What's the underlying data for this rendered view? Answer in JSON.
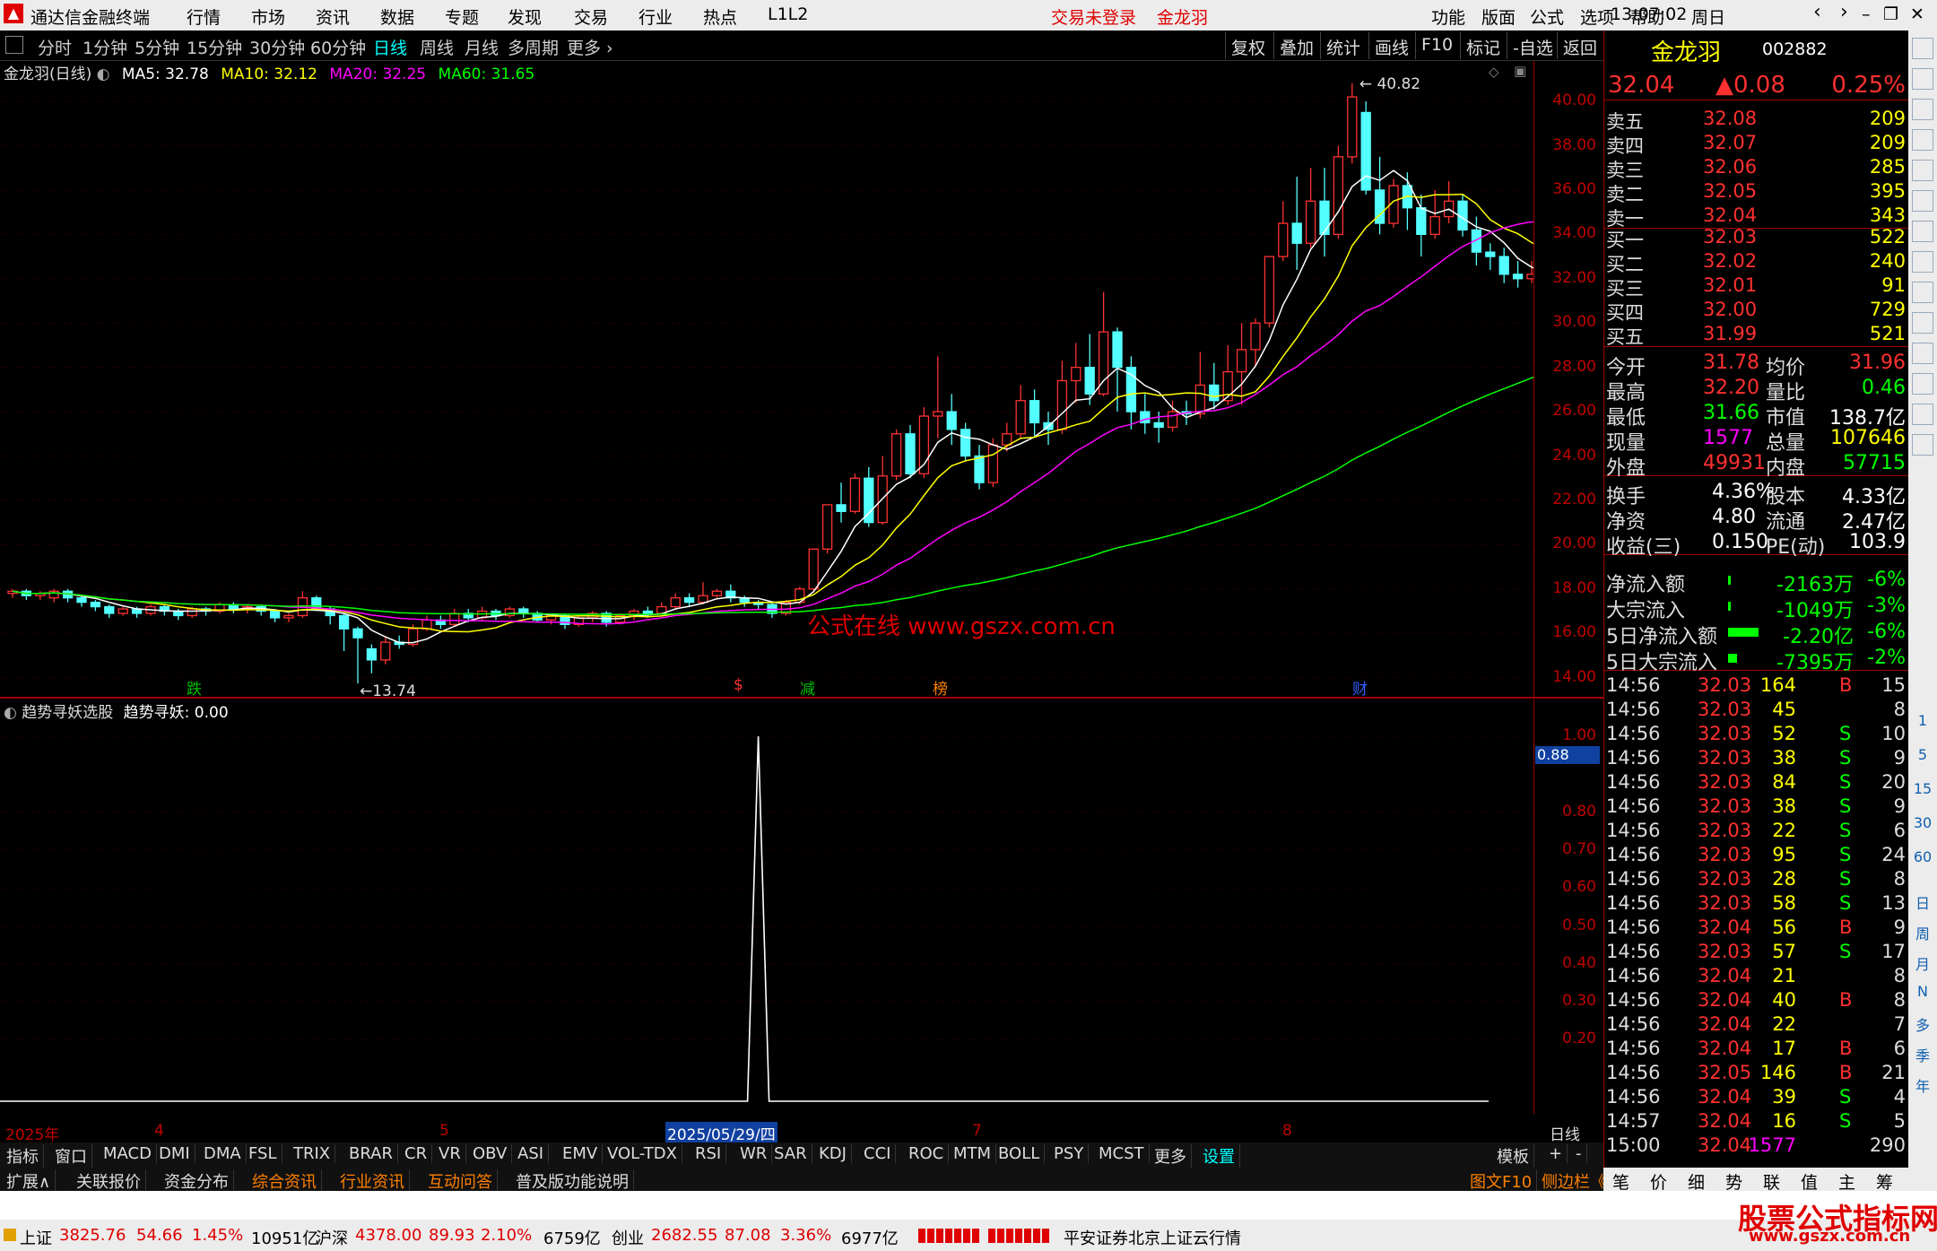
{
  "app": {
    "title": "通达信金融终端",
    "menus": [
      "行情",
      "市场",
      "资讯",
      "数据",
      "专题",
      "发现",
      "交易",
      "行业",
      "热点",
      "L1L2"
    ],
    "login_status": "交易未登录",
    "stock_name": "金龙羽",
    "right_menus": [
      "功能",
      "版面",
      "公式",
      "选项",
      "帮助"
    ],
    "time": "13:07:02",
    "weekday": "周日"
  },
  "period_tabs": [
    "分时",
    "1分钟",
    "5分钟",
    "15分钟",
    "30分钟",
    "60分钟",
    "日线",
    "周线",
    "月线",
    "多周期",
    "更多"
  ],
  "active_period": "日线",
  "toolbar_buttons": [
    "复权",
    "叠加",
    "统计",
    "画线",
    "F10",
    "标记",
    "-自选",
    "返回"
  ],
  "main_chart": {
    "header": "金龙羽(日线)",
    "ma_params": [
      {
        "label": "MA5: 32.78",
        "color": "#ffffff"
      },
      {
        "label": "MA10: 32.12",
        "color": "#ffff00"
      },
      {
        "label": "MA20: 32.25",
        "color": "#ff00ff"
      },
      {
        "label": "MA60: 31.65",
        "color": "#00ff00"
      }
    ],
    "y_ticks": [
      "40.00",
      "38.00",
      "36.00",
      "34.00",
      "32.00",
      "30.00",
      "28.00",
      "26.00",
      "24.00",
      "22.00",
      "20.00",
      "18.00",
      "16.00",
      "14.00"
    ],
    "high_label": "40.82",
    "low_label": "13.74",
    "watermark": "公式在线  www.gszx.com.cn",
    "event_markers": [
      {
        "text": "跌",
        "color": "#00c000"
      },
      {
        "text": "$",
        "color": "#ff3030"
      },
      {
        "text": "减",
        "color": "#00c000"
      },
      {
        "text": "榜",
        "color": "#ff8000"
      },
      {
        "text": "财",
        "color": "#3060ff"
      }
    ]
  },
  "chart_data": [
    {
      "type": "candlestick",
      "title": "金龙羽(日线)",
      "ylim": [
        13.5,
        41.5
      ],
      "candles": [
        [
          17.8,
          17.9,
          17.6,
          18.0
        ],
        [
          17.9,
          17.7,
          17.5,
          18.0
        ],
        [
          17.7,
          17.8,
          17.5,
          17.9
        ],
        [
          17.6,
          17.9,
          17.4,
          18.0
        ],
        [
          17.9,
          17.6,
          17.4,
          18.0
        ],
        [
          17.6,
          17.4,
          17.2,
          17.7
        ],
        [
          17.4,
          17.2,
          17.0,
          17.5
        ],
        [
          17.2,
          16.9,
          16.7,
          17.3
        ],
        [
          16.9,
          17.1,
          16.8,
          17.2
        ],
        [
          17.1,
          16.9,
          16.7,
          17.2
        ],
        [
          16.9,
          17.2,
          16.8,
          17.3
        ],
        [
          17.2,
          17.0,
          16.8,
          17.3
        ],
        [
          17.0,
          16.8,
          16.6,
          17.1
        ],
        [
          16.8,
          17.1,
          16.7,
          17.2
        ],
        [
          17.1,
          17.0,
          16.8,
          17.2
        ],
        [
          17.0,
          17.3,
          16.9,
          17.4
        ],
        [
          17.3,
          17.1,
          16.9,
          17.4
        ],
        [
          17.1,
          17.2,
          16.9,
          17.3
        ],
        [
          17.2,
          17.0,
          16.8,
          17.3
        ],
        [
          17.0,
          16.7,
          16.5,
          17.1
        ],
        [
          16.7,
          16.8,
          16.5,
          16.9
        ],
        [
          16.8,
          17.6,
          16.7,
          17.9
        ],
        [
          17.6,
          17.1,
          17.0,
          17.7
        ],
        [
          17.1,
          16.8,
          16.4,
          17.2
        ],
        [
          16.8,
          16.2,
          15.2,
          16.9
        ],
        [
          16.2,
          15.8,
          13.74,
          16.3
        ],
        [
          15.3,
          14.8,
          14.2,
          15.5
        ],
        [
          14.8,
          15.6,
          14.6,
          15.8
        ],
        [
          15.6,
          15.5,
          15.3,
          15.9
        ],
        [
          15.5,
          16.2,
          15.4,
          16.4
        ],
        [
          16.2,
          16.6,
          16.1,
          16.8
        ],
        [
          16.6,
          16.4,
          16.2,
          16.8
        ],
        [
          16.4,
          16.9,
          16.3,
          17.1
        ],
        [
          16.9,
          16.7,
          16.5,
          17.1
        ],
        [
          16.7,
          17.0,
          16.6,
          17.2
        ],
        [
          17.0,
          16.8,
          16.6,
          17.1
        ],
        [
          16.8,
          17.1,
          16.7,
          17.2
        ],
        [
          17.1,
          16.9,
          16.7,
          17.2
        ],
        [
          16.9,
          16.6,
          16.5,
          17.0
        ],
        [
          16.6,
          16.8,
          16.4,
          16.9
        ],
        [
          16.8,
          16.4,
          16.2,
          16.9
        ],
        [
          16.4,
          16.7,
          16.3,
          16.8
        ],
        [
          16.7,
          16.9,
          16.5,
          17.0
        ],
        [
          16.9,
          16.5,
          16.3,
          17.0
        ],
        [
          16.5,
          16.8,
          16.4,
          16.9
        ],
        [
          16.8,
          17.0,
          16.6,
          17.1
        ],
        [
          17.0,
          16.9,
          16.7,
          17.2
        ],
        [
          16.9,
          17.2,
          16.8,
          17.4
        ],
        [
          17.2,
          17.6,
          17.1,
          17.8
        ],
        [
          17.6,
          17.4,
          17.2,
          17.8
        ],
        [
          17.4,
          17.7,
          17.3,
          18.3
        ],
        [
          17.7,
          17.9,
          17.6,
          18.0
        ],
        [
          17.9,
          17.6,
          17.4,
          18.2
        ],
        [
          17.6,
          17.4,
          17.2,
          17.7
        ],
        [
          17.4,
          17.3,
          17.1,
          17.5
        ],
        [
          17.3,
          16.9,
          16.7,
          17.4
        ],
        [
          16.9,
          17.4,
          16.8,
          17.5
        ],
        [
          17.4,
          18.0,
          17.3,
          18.1
        ],
        [
          18.0,
          19.8,
          17.9,
          19.8
        ],
        [
          19.8,
          21.8,
          19.6,
          21.8
        ],
        [
          21.8,
          21.5,
          21.0,
          22.8
        ],
        [
          21.5,
          23.0,
          21.4,
          23.2
        ],
        [
          23.0,
          21.0,
          20.8,
          23.5
        ],
        [
          21.0,
          23.1,
          20.9,
          24.0
        ],
        [
          23.1,
          25.0,
          22.9,
          25.2
        ],
        [
          25.0,
          23.2,
          23.0,
          25.4
        ],
        [
          23.2,
          25.8,
          23.0,
          26.2
        ],
        [
          25.8,
          26.0,
          24.8,
          28.5
        ],
        [
          26.0,
          25.2,
          24.5,
          26.8
        ],
        [
          25.2,
          24.0,
          23.8,
          25.5
        ],
        [
          24.0,
          22.8,
          22.5,
          24.5
        ],
        [
          22.8,
          24.5,
          22.6,
          24.8
        ],
        [
          24.5,
          25.0,
          24.2,
          25.5
        ],
        [
          25.0,
          26.5,
          24.8,
          27.2
        ],
        [
          26.5,
          25.5,
          24.9,
          27.0
        ],
        [
          25.5,
          25.2,
          24.5,
          26.0
        ],
        [
          25.2,
          27.4,
          25.0,
          28.3
        ],
        [
          27.4,
          28.0,
          26.4,
          29.1
        ],
        [
          28.0,
          26.8,
          26.3,
          29.5
        ],
        [
          26.8,
          29.6,
          26.7,
          31.4
        ],
        [
          29.6,
          28.0,
          26.0,
          29.8
        ],
        [
          28.0,
          26.0,
          25.2,
          28.5
        ],
        [
          26.0,
          25.5,
          25.0,
          26.8
        ],
        [
          25.5,
          25.3,
          24.6,
          26.0
        ],
        [
          25.3,
          26.0,
          25.1,
          26.5
        ],
        [
          26.0,
          25.9,
          25.4,
          26.5
        ],
        [
          25.9,
          27.2,
          25.7,
          28.7
        ],
        [
          27.2,
          26.5,
          26.1,
          28.2
        ],
        [
          26.5,
          27.8,
          26.3,
          29.0
        ],
        [
          27.8,
          28.8,
          26.3,
          30.0
        ],
        [
          28.8,
          30.0,
          28.0,
          30.2
        ],
        [
          30.0,
          33.0,
          29.8,
          33.0
        ],
        [
          33.0,
          34.5,
          32.8,
          35.5
        ],
        [
          34.5,
          33.6,
          32.4,
          36.6
        ],
        [
          33.6,
          35.5,
          33.4,
          37.0
        ],
        [
          35.5,
          34.0,
          33.0,
          37.0
        ],
        [
          34.0,
          37.5,
          33.8,
          38.0
        ],
        [
          37.5,
          40.2,
          37.2,
          40.82
        ],
        [
          39.5,
          36.0,
          35.8,
          40.0
        ],
        [
          36.0,
          34.5,
          34.0,
          37.5
        ],
        [
          34.5,
          36.2,
          34.3,
          36.5
        ],
        [
          36.2,
          35.2,
          34.2,
          36.8
        ],
        [
          35.2,
          34.0,
          33.0,
          35.8
        ],
        [
          34.0,
          34.8,
          33.8,
          36.0
        ],
        [
          34.8,
          35.5,
          34.5,
          36.4
        ],
        [
          35.5,
          34.2,
          33.9,
          35.8
        ],
        [
          34.2,
          33.2,
          32.6,
          34.8
        ],
        [
          33.2,
          33.0,
          32.4,
          33.6
        ],
        [
          33.0,
          32.2,
          31.8,
          33.4
        ],
        [
          32.2,
          32.0,
          31.6,
          32.8
        ],
        [
          32.0,
          32.2,
          31.8,
          32.8
        ],
        [
          32.2,
          31.9,
          31.7,
          32.8
        ],
        [
          31.9,
          32.5,
          31.7,
          33.0
        ],
        [
          32.5,
          34.0,
          32.3,
          35.0
        ],
        [
          34.0,
          35.0,
          33.6,
          36.8
        ],
        [
          35.0,
          36.2,
          34.8,
          37.0
        ],
        [
          36.2,
          33.6,
          33.2,
          37.8
        ],
        [
          33.6,
          33.2,
          33.0,
          34.0
        ],
        [
          33.2,
          33.5,
          33.0,
          34.0
        ],
        [
          33.5,
          33.1,
          32.8,
          33.8
        ],
        [
          33.1,
          33.6,
          32.9,
          34.2
        ],
        [
          33.6,
          34.5,
          33.4,
          35.0
        ],
        [
          34.5,
          35.5,
          34.3,
          36.0
        ],
        [
          35.5,
          34.5,
          34.0,
          35.8
        ],
        [
          34.5,
          33.6,
          33.2,
          34.6
        ],
        [
          33.6,
          32.0,
          31.7,
          34.0
        ],
        [
          32.0,
          31.6,
          31.4,
          32.4
        ],
        [
          31.6,
          32.2,
          31.2,
          32.6
        ],
        [
          32.2,
          31.2,
          30.8,
          32.4
        ],
        [
          31.2,
          31.8,
          31.0,
          32.2
        ],
        [
          31.8,
          32.0,
          31.6,
          32.3
        ],
        [
          32.0,
          31.8,
          31.5,
          32.2
        ],
        [
          31.8,
          31.6,
          31.3,
          32.0
        ],
        [
          31.6,
          31.8,
          31.4,
          32.0
        ],
        [
          31.8,
          31.5,
          31.2,
          32.0
        ],
        [
          31.5,
          31.3,
          31.0,
          31.8
        ],
        [
          31.3,
          31.0,
          30.6,
          31.5
        ],
        [
          31.0,
          31.2,
          30.7,
          31.5
        ],
        [
          31.2,
          31.4,
          31.0,
          31.6
        ],
        [
          31.4,
          31.7,
          31.2,
          31.9
        ],
        [
          31.7,
          32.0,
          31.5,
          32.2
        ],
        [
          32.0,
          32.4,
          31.8,
          32.6
        ],
        [
          32.4,
          33.2,
          32.2,
          33.5
        ],
        [
          33.2,
          33.8,
          33.0,
          34.4
        ],
        [
          33.8,
          33.4,
          33.2,
          34.0
        ],
        [
          33.4,
          32.4,
          31.8,
          33.6
        ],
        [
          32.4,
          32.0,
          31.7,
          32.6
        ],
        [
          31.78,
          32.04,
          31.66,
          32.2
        ]
      ]
    },
    {
      "type": "line",
      "title": "趋势寻妖选股",
      "ylim": [
        0,
        1.05
      ],
      "spike_index": 54,
      "values_note_value": "0.00"
    }
  ],
  "sub_chart": {
    "header": "趋势寻妖选股",
    "param": "趋势寻妖: 0.00",
    "y_ticks": [
      "1.00",
      "0.80",
      "0.70",
      "0.60",
      "0.50",
      "0.40",
      "0.30",
      "0.20"
    ],
    "cursor_value": "0.88"
  },
  "time_axis": {
    "labels": [
      "2025年",
      "4",
      "5",
      "2025/05/29/四",
      "7",
      "8"
    ],
    "period_label": "日线"
  },
  "indicator_tabs": [
    "指标",
    "窗口",
    "MACD",
    "DMI",
    "DMA",
    "FSL",
    "TRIX",
    "BRAR",
    "CR",
    "VR",
    "OBV",
    "ASI",
    "EMV",
    "VOL-TDX",
    "RSI",
    "WR",
    "SAR",
    "KDJ",
    "CCI",
    "ROC",
    "MTM",
    "BOLL",
    "PSY",
    "MCST",
    "更多",
    "设置"
  ],
  "template_label": "模板",
  "ext_tabs": [
    "扩展∧",
    "关联报价",
    "资金分布",
    "综合资讯",
    "行业资讯",
    "互动问答",
    "普及版功能说明"
  ],
  "ext_right": [
    "图文F10",
    "侧边栏《"
  ],
  "quote": {
    "name": "金龙羽",
    "code": "002882",
    "price": "32.04",
    "change": "▲0.08",
    "pct": "0.25%",
    "sells": [
      [
        "卖五",
        "32.08",
        "209"
      ],
      [
        "卖四",
        "32.07",
        "209"
      ],
      [
        "卖三",
        "32.06",
        "285"
      ],
      [
        "卖二",
        "32.05",
        "395"
      ],
      [
        "卖一",
        "32.04",
        "343"
      ]
    ],
    "buys": [
      [
        "买一",
        "32.03",
        "522"
      ],
      [
        "买二",
        "32.02",
        "240"
      ],
      [
        "买三",
        "32.01",
        "91"
      ],
      [
        "买四",
        "32.00",
        "729"
      ],
      [
        "买五",
        "31.99",
        "521"
      ]
    ],
    "stats": [
      [
        "今开",
        "31.78",
        "均价",
        "31.96"
      ],
      [
        "最高",
        "32.20",
        "量比",
        "0.46"
      ],
      [
        "最低",
        "31.66",
        "市值",
        "138.7亿"
      ],
      [
        "现量",
        "1577",
        "总量",
        "107646"
      ],
      [
        "外盘",
        "49931",
        "内盘",
        "57715"
      ]
    ],
    "stats2": [
      [
        "换手",
        "4.36%",
        "股本",
        "4.33亿"
      ],
      [
        "净资",
        "4.80",
        "流通",
        "2.47亿"
      ],
      [
        "收益(三)",
        "0.150",
        "PE(动)",
        "103.9"
      ]
    ],
    "flows": [
      [
        "净流入额",
        "-2163万",
        "-6%"
      ],
      [
        "大宗流入",
        "-1049万",
        "-3%"
      ],
      [
        "5日净流入额",
        "-2.20亿",
        "-6%"
      ],
      [
        "5日大宗流入",
        "-7395万",
        "-2%"
      ]
    ],
    "ticks": [
      [
        "14:56",
        "32.03",
        "164",
        "B",
        "15"
      ],
      [
        "14:56",
        "32.03",
        "45",
        "",
        "8"
      ],
      [
        "14:56",
        "32.03",
        "52",
        "S",
        "10"
      ],
      [
        "14:56",
        "32.03",
        "38",
        "S",
        "9"
      ],
      [
        "14:56",
        "32.03",
        "84",
        "S",
        "20"
      ],
      [
        "14:56",
        "32.03",
        "38",
        "S",
        "9"
      ],
      [
        "14:56",
        "32.03",
        "22",
        "S",
        "6"
      ],
      [
        "14:56",
        "32.03",
        "95",
        "S",
        "24"
      ],
      [
        "14:56",
        "32.03",
        "28",
        "S",
        "8"
      ],
      [
        "14:56",
        "32.03",
        "58",
        "S",
        "13"
      ],
      [
        "14:56",
        "32.04",
        "56",
        "B",
        "9"
      ],
      [
        "14:56",
        "32.03",
        "57",
        "S",
        "17"
      ],
      [
        "14:56",
        "32.04",
        "21",
        "",
        "8"
      ],
      [
        "14:56",
        "32.04",
        "40",
        "B",
        "8"
      ],
      [
        "14:56",
        "32.04",
        "22",
        "",
        "7"
      ],
      [
        "14:56",
        "32.04",
        "17",
        "B",
        "6"
      ],
      [
        "14:56",
        "32.05",
        "146",
        "B",
        "21"
      ],
      [
        "14:56",
        "32.04",
        "39",
        "S",
        "4"
      ],
      [
        "14:57",
        "32.04",
        "16",
        "S",
        "5"
      ],
      [
        "15:00",
        "32.04",
        "1577",
        "",
        "290"
      ]
    ]
  },
  "bottom_quote_tabs": [
    "笔",
    "价",
    "细",
    "势",
    "联",
    "值",
    "主",
    "筹"
  ],
  "sidebar_labels": [
    "日",
    "周",
    "月",
    "N",
    "多",
    "季",
    "年"
  ],
  "sidebar_numbers": [
    "1",
    "5",
    "15",
    "30",
    "60"
  ],
  "status": {
    "sh_label": "上证",
    "sh": "3825.76",
    "sh_chg": "54.66",
    "sh_pct": "1.45%",
    "sh_amt": "10951亿",
    "hs_label": "沪深",
    "hs": "4378.00",
    "hs_chg": "89.93",
    "hs_pct": "2.10%",
    "hs_amt": "6759亿",
    "cy_label": "创业",
    "cy": "2682.55",
    "cy_chg": "87.08",
    "cy_pct": "3.36%",
    "cy_amt": "6977亿",
    "broker": "平安证券北京上证云行情",
    "brand": "股票公式指标网",
    "brand_url": "www.gszx.com.cn"
  }
}
